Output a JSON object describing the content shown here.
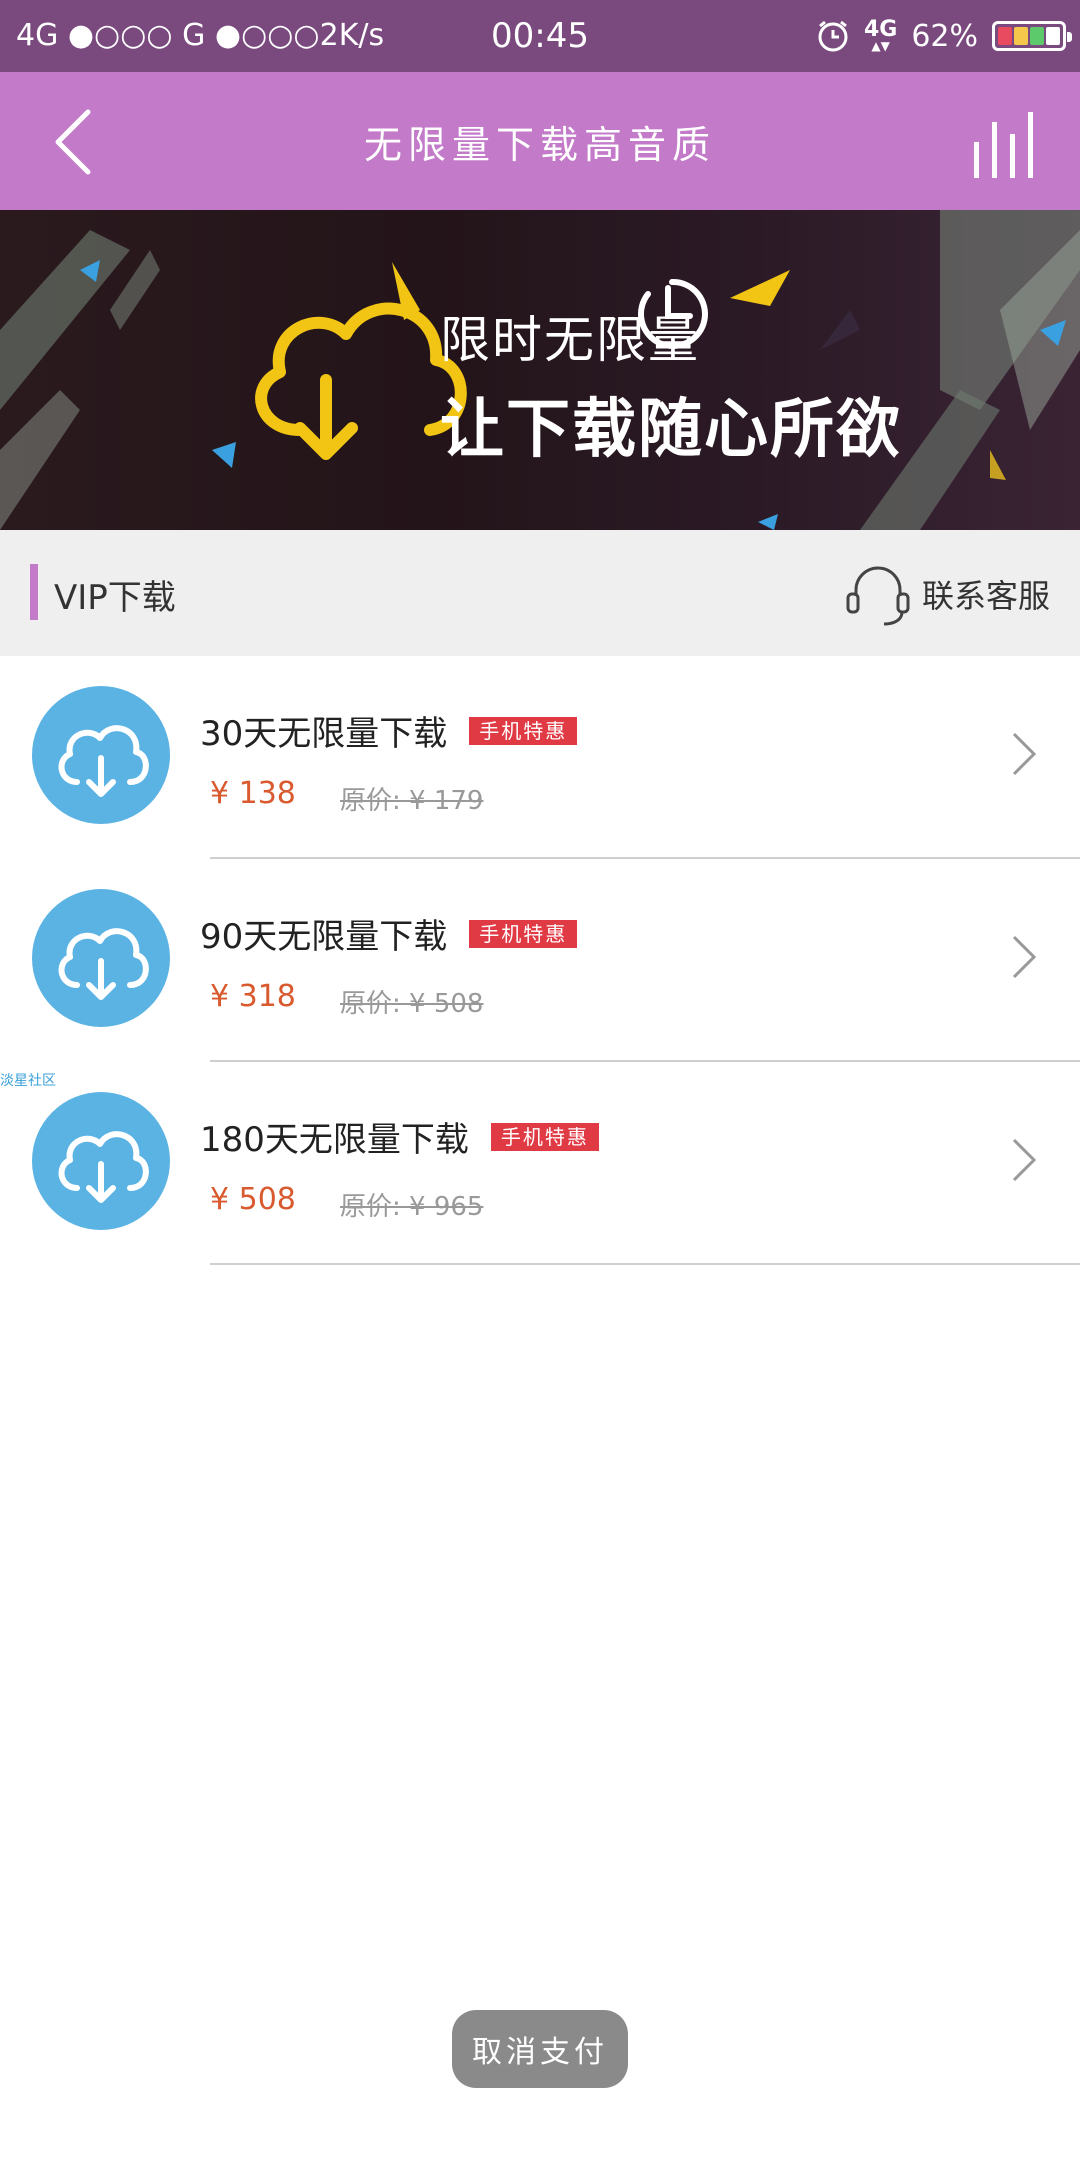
{
  "status_bar": {
    "left_text": "4G ●○○○ G ●○○○2K/s",
    "time": "00:45",
    "network": "4G",
    "battery": "62%"
  },
  "header": {
    "title": "无限量下载高音质",
    "back_icon": "back-arrow-icon",
    "equalizer_icon": "equalizer-icon"
  },
  "banner": {
    "line1": "限时无限量",
    "line2": "让下载随心所欲"
  },
  "section": {
    "title": "VIP下载",
    "contact_label": "联系客服"
  },
  "plans": [
    {
      "name": "30天无限量下载",
      "badge": "手机特惠",
      "price": "¥ 138",
      "original_price": "原价: ¥ 179"
    },
    {
      "name": "90天无限量下载",
      "badge": "手机特惠",
      "price": "¥ 318",
      "original_price": "原价: ¥ 508"
    },
    {
      "name": "180天无限量下载",
      "badge": "手机特惠",
      "price": "¥ 508",
      "original_price": "原价: ¥ 965"
    }
  ],
  "watermark": "淡星社区",
  "cancel_button": "取消支付",
  "colors": {
    "status_bar": "#7a4a7f",
    "header": "#c27ac9",
    "accent": "#c27ac9",
    "badge": "#e03a44",
    "price": "#d85a2e",
    "cloud_icon": "#5bb3e4"
  }
}
